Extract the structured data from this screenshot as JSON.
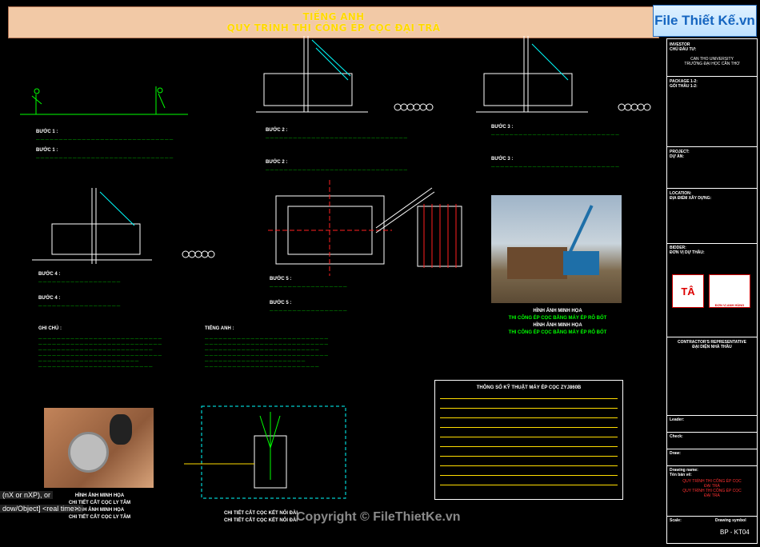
{
  "banner": {
    "line1": "TIẾNG ANH",
    "line2": "QUY TRÌNH THI CÔNG ÉP CỌC ĐẠI TRÀ"
  },
  "watermark": {
    "text": "File Thiết Kế.vn"
  },
  "colors": {
    "drawing": "#00ff00",
    "crane": "#00ffff",
    "red": "#ff2020",
    "yellow": "#ffdd00",
    "background": "#000000"
  },
  "steps": {
    "s1a": "BƯỚC 1 :",
    "s1b": "BƯỚC 1 :",
    "s2a": "BƯỚC 2 :",
    "s2b": "BƯỚC 2 :",
    "s3a": "BƯỚC 3 :",
    "s3b": "BƯỚC 3 :",
    "s4a": "BƯỚC 4 :",
    "s4b": "BƯỚC 4 :",
    "s5a": "BƯỚC 5 :",
    "s5b": "BƯỚC 5 :"
  },
  "notes": {
    "ghichu": "GHI CHÚ :",
    "tienganh": "TIẾNG ANH :"
  },
  "captions": {
    "photo1_l1": "HÌNH ẢNH MINH HỌA",
    "photo1_l2": "THI CÔNG ÉP CỌC BẰNG MÁY ÉP RÔ BỐT",
    "photo1_l3": "HÌNH ẢNH MINH HỌA",
    "photo1_l4": "THI CÔNG ÉP CỌC BẰNG MÁY ÉP RÔ BỐT",
    "photo2_l1": "HÌNH ẢNH MINH HỌA",
    "photo2_l2": "CHI TIẾT CẮT CỌC LY TÂM",
    "photo2_l3": "HÌNH ẢNH MINH HỌA",
    "photo2_l4": "CHI TIẾT CẮT CỌC LY TÂM",
    "detail_l1": "CHI TIẾT CẮT CỌC KẾT NỐI ĐÀI",
    "detail_l2": "CHI TIẾT CẮT CỌC KẾT NỐI ĐÀI"
  },
  "table": {
    "title": "THÔNG SỐ KỸ THUẬT MÁY ÉP CỌC ZYJ860B"
  },
  "panel": {
    "investor": "INVESTOR\nCHỦ ĐẦU TƯ:",
    "investor_v": "CAN THO UNIVERSITY\nTRƯỜNG ĐẠI HỌC CẦN THƠ",
    "package": "PACKAGE 1-2:\nGÓI THẦU 1-2:",
    "project": "PROJECT:\nDỰ ÁN:",
    "location": "LOCATION:\nĐỊA ĐIỂM XÂY DỰNG:",
    "bidder": "BIDDER:\nĐƠN VỊ DỰ THẦU:",
    "logo_left": "TÂ",
    "logo_right": "ĐƠN VỊ ANH HÙNG",
    "contractor": "CONTRACTOR'S REPRESENTATIVE\nĐẠI DIỆN NHÀ THẦU",
    "leader": "Leader:",
    "checker": "Check:",
    "drawer": "Draw:",
    "drawing_name": "Drawing name:\nTên bản vẽ:",
    "drawing_name_v": "QUY TRÌNH THI CÔNG ÉP CỌC\nĐẠI TRÀ\nQUY TRÌNH THI CÔNG ÉP CỌC\nĐẠI TRÀ",
    "scale": "Scale:",
    "drawing_symbol": "Drawing symbol",
    "symbol_v": "BP - KT04"
  },
  "cmdline": {
    "line1": "(nX or nXP), or",
    "line2": "dow/Object] <real time>:"
  },
  "copyright": "Copyright © FileThietKe.vn"
}
